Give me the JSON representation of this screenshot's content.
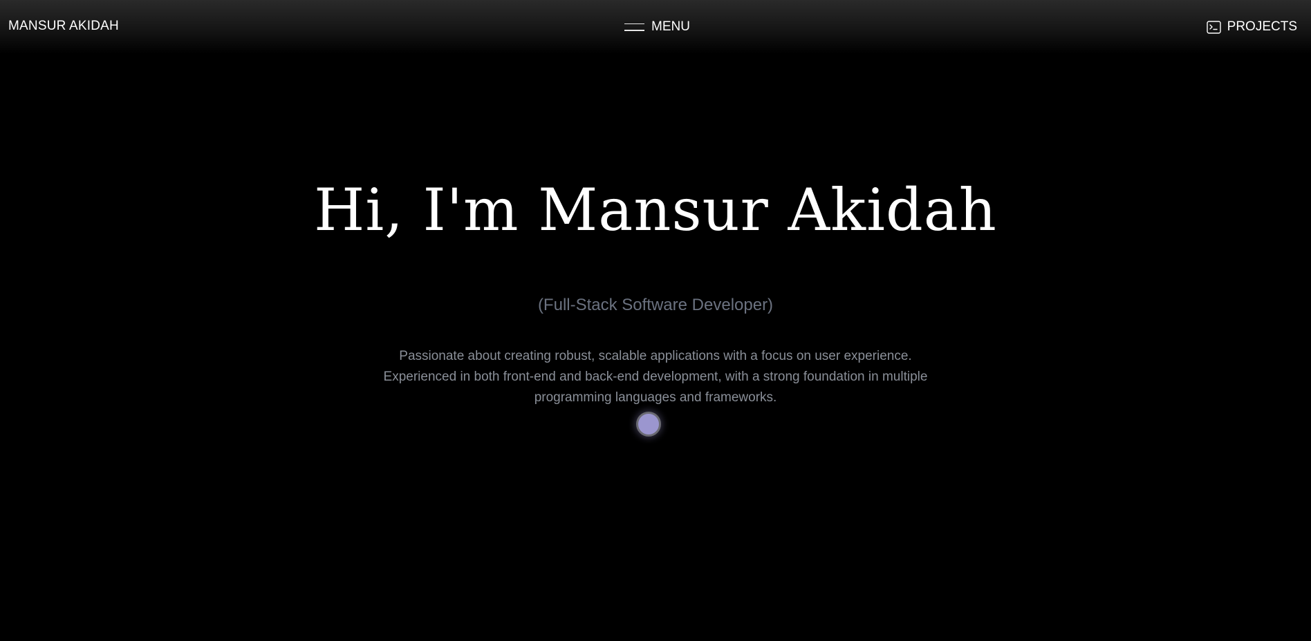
{
  "header": {
    "brand": "MANSUR AKIDAH",
    "menu_label": "MENU",
    "projects_label": "PROJECTS"
  },
  "hero": {
    "title": "Hi, I'm Mansur Akidah",
    "subtitle": "(Full-Stack Software Developer)",
    "description_lines": [
      "Passionate about creating robust, scalable applications with a focus on user experience.",
      "Experienced in both front-end and back-end development, with a strong foundation in multiple",
      "programming languages and frameworks."
    ]
  },
  "icons": {
    "menu": "hamburger-icon",
    "projects": "terminal-icon"
  },
  "colors": {
    "background": "#000000",
    "text": "#ffffff",
    "subtitle": "#6b7280",
    "description": "#8a8f98",
    "cursor": "#9b96cf"
  }
}
